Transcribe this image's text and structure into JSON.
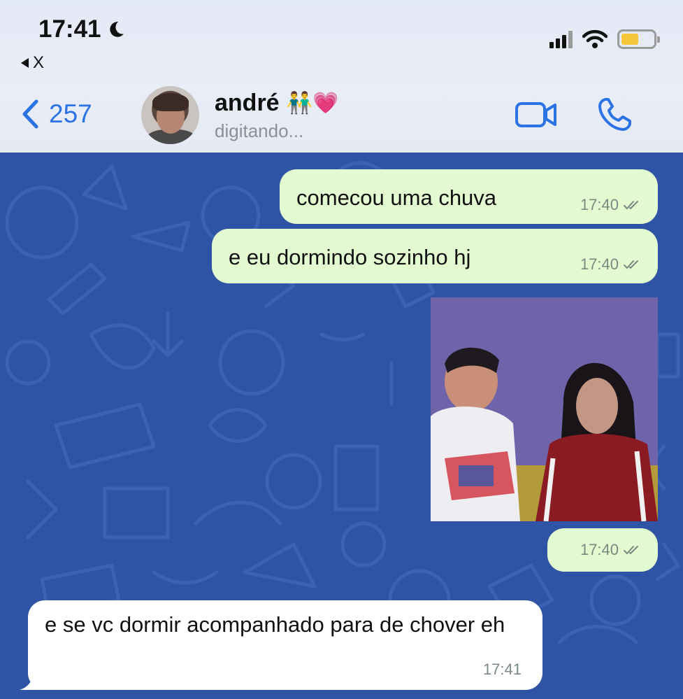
{
  "status_bar": {
    "time": "17:41",
    "back_app_label": "X"
  },
  "nav": {
    "back_count": "257",
    "contact_name": "andré",
    "contact_emoji": "👬💗",
    "status": "digitando..."
  },
  "messages": [
    {
      "direction": "outgoing",
      "text": "comecou uma chuva",
      "time": "17:40",
      "read": true
    },
    {
      "direction": "outgoing",
      "text": "e eu dormindo sozinho hj",
      "time": "17:40",
      "read": true
    },
    {
      "direction": "outgoing",
      "type": "photo",
      "text": "",
      "time": "17:40",
      "read": true
    },
    {
      "direction": "incoming",
      "text": "e se vc dormir acompanhado para de chover eh",
      "time": "17:41"
    }
  ],
  "colors": {
    "accent": "#2b72e4",
    "outgoing_bubble": "#e2fbd0",
    "incoming_bubble": "#ffffff",
    "chat_background": "#2f54a5",
    "battery": "#f5c53a"
  },
  "icons": {
    "back": "chevron-left-icon",
    "video": "video-camera-icon",
    "call": "phone-icon",
    "read": "double-check-icon",
    "moon": "moon-icon"
  }
}
